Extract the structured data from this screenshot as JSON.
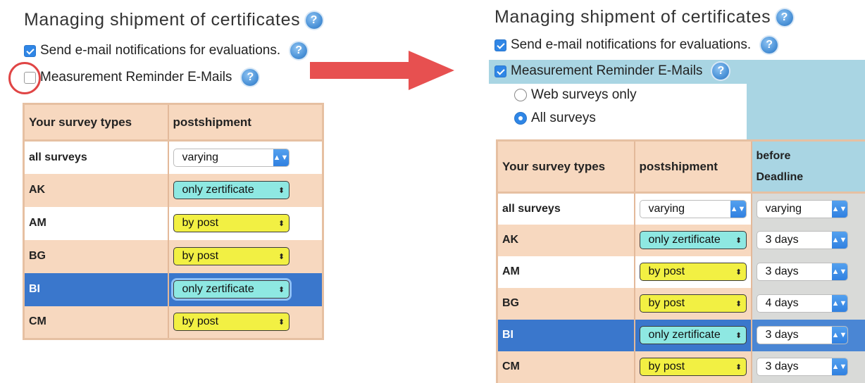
{
  "colors": {
    "peach": "#f7d8bf",
    "selected_row": "#3a77cc",
    "help_blue": "#4c93d8",
    "checkbox_blue": "#2f86e6",
    "select_cyan": "#8ee8e2",
    "select_yellow": "#f2f043",
    "highlight_ring": "#e04545",
    "arrow": "#e75050",
    "panel_blue": "#a9d5e3"
  },
  "left": {
    "title": "Managing shipment of certificates",
    "help_icon": "?",
    "email_notifications": {
      "label": "Send e-mail notifications for evaluations.",
      "checked": true
    },
    "measurement_reminder": {
      "label": "Measurement Reminder E-Mails",
      "checked": false
    },
    "table": {
      "headers": [
        "Your survey types",
        "postshipment"
      ],
      "rows": [
        {
          "type": "all surveys",
          "postshipment": "varying"
        },
        {
          "type": "AK",
          "postshipment": "only zertificate"
        },
        {
          "type": "AM",
          "postshipment": "by post"
        },
        {
          "type": "BG",
          "postshipment": "by post"
        },
        {
          "type": "BI",
          "postshipment": "only zertificate"
        },
        {
          "type": "CM",
          "postshipment": "by post"
        }
      ]
    }
  },
  "right": {
    "title": "Managing shipment of certificates",
    "help_icon": "?",
    "email_notifications": {
      "label": "Send e-mail notifications for evaluations.",
      "checked": true
    },
    "measurement_reminder": {
      "label": "Measurement Reminder E-Mails",
      "checked": true
    },
    "radio_web": {
      "label": "Web surveys only",
      "selected": false
    },
    "radio_all": {
      "label": "All surveys",
      "selected": true
    },
    "table": {
      "headers": [
        "Your survey types",
        "postshipment",
        "before",
        "Deadline"
      ],
      "rows": [
        {
          "type": "all surveys",
          "postshipment": "varying",
          "before": "varying"
        },
        {
          "type": "AK",
          "postshipment": "only zertificate",
          "before": "3 days"
        },
        {
          "type": "AM",
          "postshipment": "by post",
          "before": "3 days"
        },
        {
          "type": "BG",
          "postshipment": "by post",
          "before": "4 days"
        },
        {
          "type": "BI",
          "postshipment": "only zertificate",
          "before": "3 days"
        },
        {
          "type": "CM",
          "postshipment": "by post",
          "before": "3 days"
        }
      ]
    }
  }
}
